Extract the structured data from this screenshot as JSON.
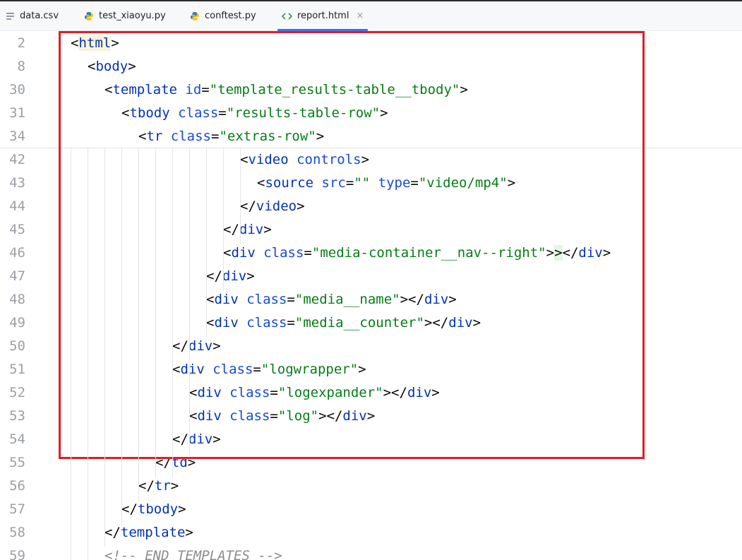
{
  "tabs": [
    {
      "label": "data.csv",
      "icon": "text-file-icon"
    },
    {
      "label": "test_xiaoyu.py",
      "icon": "python-file-icon"
    },
    {
      "label": "conftest.py",
      "icon": "python-file-icon"
    },
    {
      "label": "report.html",
      "icon": "html-file-icon",
      "active": true,
      "close": "×"
    }
  ],
  "lines": [
    {
      "num": "2",
      "indent": 0,
      "segs": [
        [
          "punct",
          "<"
        ],
        [
          "tag hl-match",
          "html"
        ],
        [
          "punct",
          ">"
        ]
      ]
    },
    {
      "num": "8",
      "indent": 1,
      "segs": [
        [
          "punct",
          "<"
        ],
        [
          "tag",
          "body"
        ],
        [
          "punct",
          ">"
        ]
      ]
    },
    {
      "num": "30",
      "indent": 2,
      "segs": [
        [
          "punct",
          "<"
        ],
        [
          "tag",
          "template "
        ],
        [
          "attr",
          "id"
        ],
        [
          "punct",
          "="
        ],
        [
          "val",
          "\"template_results-table__tbody\""
        ],
        [
          "punct",
          ">"
        ]
      ]
    },
    {
      "num": "31",
      "indent": 3,
      "segs": [
        [
          "punct",
          "<"
        ],
        [
          "tag",
          "tbody "
        ],
        [
          "attr",
          "class"
        ],
        [
          "punct",
          "="
        ],
        [
          "val",
          "\"results-table-row\""
        ],
        [
          "punct",
          ">"
        ]
      ]
    },
    {
      "num": "34",
      "indent": 4,
      "segs": [
        [
          "punct",
          "<"
        ],
        [
          "tag",
          "tr "
        ],
        [
          "attr",
          "class"
        ],
        [
          "punct",
          "="
        ],
        [
          "val",
          "\"extras-row\""
        ],
        [
          "punct",
          ">"
        ]
      ]
    },
    {
      "num": "42",
      "indent": 10,
      "segs": [
        [
          "punct",
          "<"
        ],
        [
          "tag",
          "video "
        ],
        [
          "attr",
          "controls"
        ],
        [
          "punct",
          ">"
        ]
      ]
    },
    {
      "num": "43",
      "indent": 11,
      "segs": [
        [
          "punct",
          "<"
        ],
        [
          "tag",
          "source "
        ],
        [
          "attr",
          "src"
        ],
        [
          "punct",
          "="
        ],
        [
          "val",
          "\"\" "
        ],
        [
          "attr",
          "type"
        ],
        [
          "punct",
          "="
        ],
        [
          "val",
          "\"video/mp4\""
        ],
        [
          "punct",
          ">"
        ]
      ]
    },
    {
      "num": "44",
      "indent": 10,
      "segs": [
        [
          "punct",
          "</"
        ],
        [
          "tag",
          "video"
        ],
        [
          "punct",
          ">"
        ]
      ]
    },
    {
      "num": "45",
      "indent": 9,
      "segs": [
        [
          "punct",
          "</"
        ],
        [
          "tag",
          "div"
        ],
        [
          "punct",
          ">"
        ]
      ]
    },
    {
      "num": "46",
      "indent": 9,
      "segs": [
        [
          "punct",
          "<"
        ],
        [
          "tag",
          "div "
        ],
        [
          "attr",
          "class"
        ],
        [
          "punct",
          "="
        ],
        [
          "val",
          "\"media-container__nav--right\""
        ],
        [
          "punct",
          ">"
        ],
        [
          "punct hl-bracket",
          ">"
        ],
        [
          "punct",
          "</"
        ],
        [
          "tag",
          "div"
        ],
        [
          "punct",
          ">"
        ]
      ]
    },
    {
      "num": "47",
      "indent": 8,
      "segs": [
        [
          "punct",
          "</"
        ],
        [
          "tag",
          "div"
        ],
        [
          "punct",
          ">"
        ]
      ]
    },
    {
      "num": "48",
      "indent": 8,
      "segs": [
        [
          "punct",
          "<"
        ],
        [
          "tag",
          "div "
        ],
        [
          "attr",
          "class"
        ],
        [
          "punct",
          "="
        ],
        [
          "val",
          "\"media__name\""
        ],
        [
          "punct",
          ">"
        ],
        [
          "punct",
          "</"
        ],
        [
          "tag",
          "div"
        ],
        [
          "punct",
          ">"
        ]
      ]
    },
    {
      "num": "49",
      "indent": 8,
      "segs": [
        [
          "punct",
          "<"
        ],
        [
          "tag",
          "div "
        ],
        [
          "attr",
          "class"
        ],
        [
          "punct",
          "="
        ],
        [
          "val",
          "\"media__counter\""
        ],
        [
          "punct",
          ">"
        ],
        [
          "punct",
          "</"
        ],
        [
          "tag",
          "div"
        ],
        [
          "punct",
          ">"
        ]
      ]
    },
    {
      "num": "50",
      "indent": 6,
      "segs": [
        [
          "punct",
          "</"
        ],
        [
          "tag",
          "div"
        ],
        [
          "punct",
          ">"
        ]
      ]
    },
    {
      "num": "51",
      "indent": 6,
      "segs": [
        [
          "punct",
          "<"
        ],
        [
          "tag",
          "div "
        ],
        [
          "attr",
          "class"
        ],
        [
          "punct",
          "="
        ],
        [
          "val",
          "\"logwrapper\""
        ],
        [
          "punct",
          ">"
        ]
      ]
    },
    {
      "num": "52",
      "indent": 7,
      "segs": [
        [
          "punct",
          "<"
        ],
        [
          "tag",
          "div "
        ],
        [
          "attr",
          "class"
        ],
        [
          "punct",
          "="
        ],
        [
          "val",
          "\"logexpander\""
        ],
        [
          "punct",
          ">"
        ],
        [
          "punct",
          "</"
        ],
        [
          "tag",
          "div"
        ],
        [
          "punct",
          ">"
        ]
      ]
    },
    {
      "num": "53",
      "indent": 7,
      "segs": [
        [
          "punct",
          "<"
        ],
        [
          "tag",
          "div "
        ],
        [
          "attr",
          "class"
        ],
        [
          "punct",
          "="
        ],
        [
          "val",
          "\"log\""
        ],
        [
          "punct",
          ">"
        ],
        [
          "punct",
          "</"
        ],
        [
          "tag",
          "div"
        ],
        [
          "punct",
          ">"
        ]
      ]
    },
    {
      "num": "54",
      "indent": 6,
      "segs": [
        [
          "punct",
          "</"
        ],
        [
          "tag",
          "div"
        ],
        [
          "punct",
          ">"
        ]
      ]
    },
    {
      "num": "55",
      "indent": 5,
      "segs": [
        [
          "punct",
          "</"
        ],
        [
          "tag",
          "td"
        ],
        [
          "punct",
          ">"
        ]
      ]
    },
    {
      "num": "56",
      "indent": 4,
      "segs": [
        [
          "punct",
          "</"
        ],
        [
          "tag",
          "tr"
        ],
        [
          "punct",
          ">"
        ]
      ]
    },
    {
      "num": "57",
      "indent": 3,
      "segs": [
        [
          "punct",
          "</"
        ],
        [
          "tag",
          "tbody"
        ],
        [
          "punct",
          ">"
        ]
      ]
    },
    {
      "num": "58",
      "indent": 2,
      "segs": [
        [
          "punct",
          "</"
        ],
        [
          "tag",
          "template"
        ],
        [
          "punct",
          ">"
        ]
      ]
    },
    {
      "num": "59",
      "indent": 2,
      "segs": [
        [
          "comment",
          "<!-- END TEMPLATES -->"
        ]
      ]
    }
  ]
}
